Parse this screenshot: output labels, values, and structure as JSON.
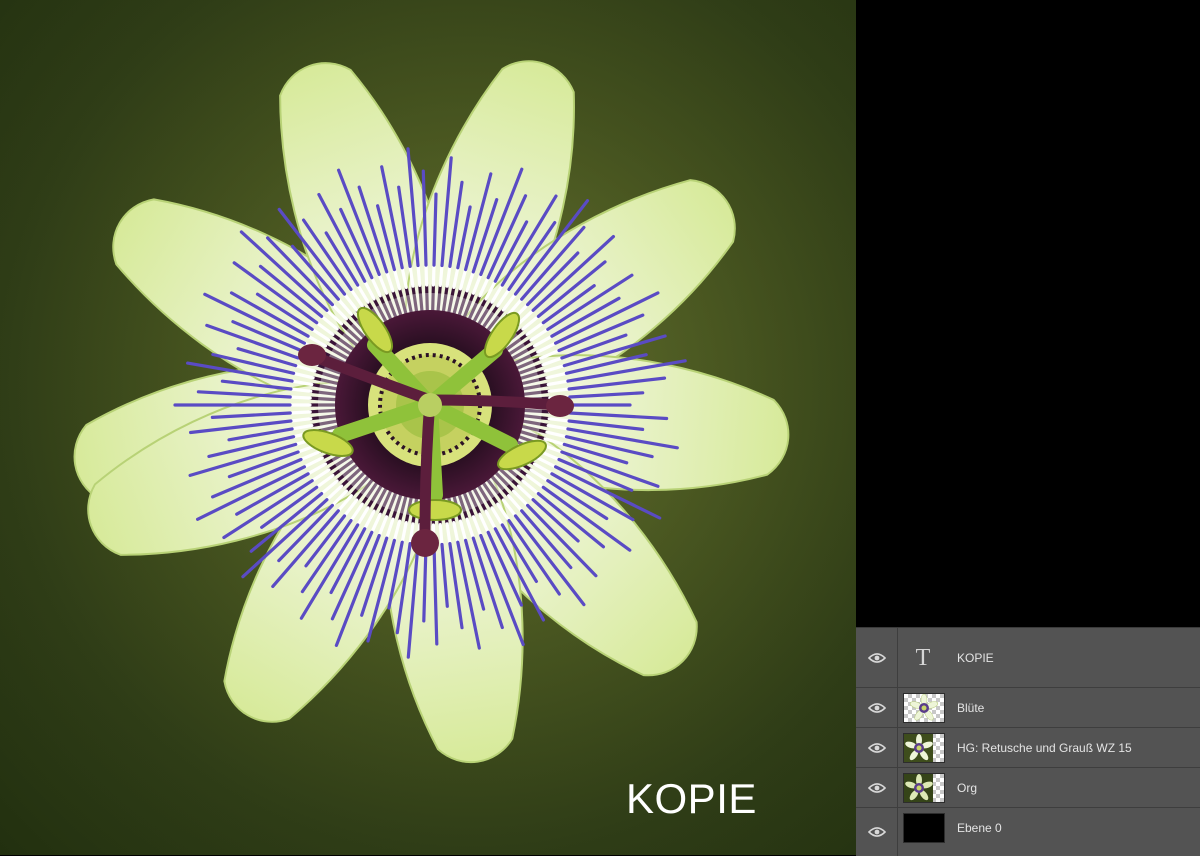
{
  "canvas": {
    "watermark_text": "KOPIE",
    "background_colors": [
      "#5d6a2c",
      "#2f3d17"
    ],
    "image_subject": "passion-flower"
  },
  "layers_panel": {
    "layers": [
      {
        "name": "KOPIE",
        "type": "text",
        "visible": true,
        "thumbnail": "text-T-icon"
      },
      {
        "name": "Blüte",
        "type": "pixel",
        "visible": true,
        "thumbnail": "flower-on-transparent"
      },
      {
        "name": "HG: Retusche und Grauß WZ 15",
        "type": "pixel",
        "visible": true,
        "thumbnail": "flower-on-background"
      },
      {
        "name": "Org",
        "type": "pixel",
        "visible": true,
        "thumbnail": "flower-original"
      },
      {
        "name": "Ebene 0",
        "type": "pixel",
        "visible": true,
        "thumbnail": "black-fill"
      }
    ],
    "colors": {
      "panel_bg": "#535353",
      "text": "#e4e4e4",
      "divider": "#3e3e3e"
    }
  }
}
